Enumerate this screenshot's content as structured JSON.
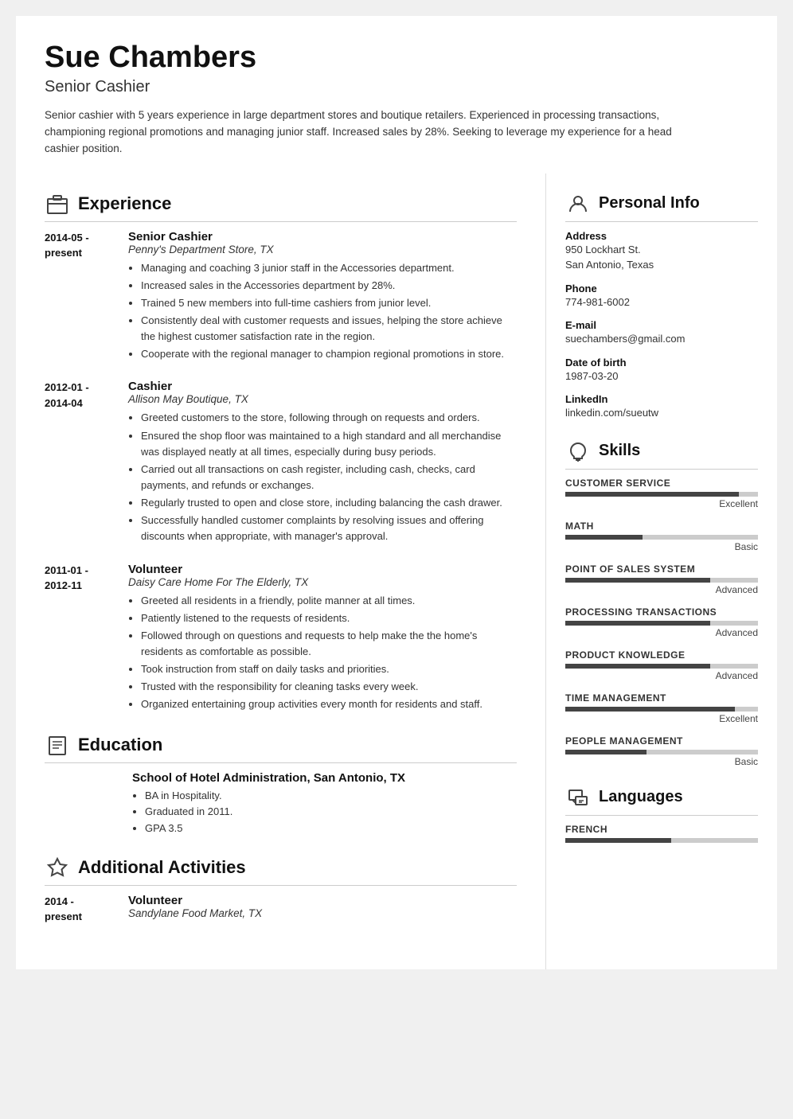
{
  "header": {
    "name": "Sue Chambers",
    "title": "Senior Cashier",
    "summary": "Senior cashier with 5 years experience in large department stores and boutique retailers. Experienced in processing transactions, championing regional promotions and managing junior staff. Increased sales by 28%. Seeking to leverage my experience for a head cashier position."
  },
  "sections": {
    "experience_label": "Experience",
    "education_label": "Education",
    "activities_label": "Additional Activities"
  },
  "experience": [
    {
      "date": "2014-05 -\npresent",
      "title": "Senior Cashier",
      "company": "Penny's Department Store, TX",
      "bullets": [
        "Managing and coaching 3 junior staff in the Accessories department.",
        "Increased sales in the Accessories department by 28%.",
        "Trained 5 new members into full-time cashiers from junior level.",
        "Consistently deal with customer requests and issues, helping the store achieve the highest customer satisfaction rate in the region.",
        "Cooperate with the regional manager to champion regional promotions in store."
      ]
    },
    {
      "date": "2012-01 -\n2014-04",
      "title": "Cashier",
      "company": "Allison May Boutique, TX",
      "bullets": [
        "Greeted customers to the store, following through on requests and orders.",
        "Ensured the shop floor was maintained to a high standard and all merchandise was displayed neatly at all times, especially during busy periods.",
        "Carried out all transactions on cash register, including cash, checks, card payments, and refunds or exchanges.",
        "Regularly trusted to open and close store, including balancing the cash drawer.",
        "Successfully handled customer complaints by resolving issues and offering discounts when appropriate, with manager's approval."
      ]
    },
    {
      "date": "2011-01 -\n2012-11",
      "title": "Volunteer",
      "company": "Daisy Care Home For The Elderly, TX",
      "bullets": [
        "Greeted all residents in a friendly, polite manner at all times.",
        "Patiently listened to the requests of residents.",
        "Followed through on questions and requests to help make the the home's residents as comfortable as possible.",
        "Took instruction from staff on daily tasks and priorities.",
        "Trusted with the responsibility for cleaning tasks every week.",
        "Organized entertaining group activities every month for residents and staff."
      ]
    }
  ],
  "education": [
    {
      "school": "School of Hotel Administration, San Antonio, TX",
      "bullets": [
        "BA in Hospitality.",
        "Graduated in 2011.",
        "GPA 3.5"
      ]
    }
  ],
  "activities": [
    {
      "date": "2014 -\npresent",
      "title": "Volunteer",
      "company": "Sandylane Food Market, TX"
    }
  ],
  "personal_info": {
    "section_label": "Personal Info",
    "address_label": "Address",
    "address_line1": "950 Lockhart St.",
    "address_line2": "San Antonio, Texas",
    "phone_label": "Phone",
    "phone": "774-981-6002",
    "email_label": "E-mail",
    "email": "suechambers@gmail.com",
    "dob_label": "Date of birth",
    "dob": "1987-03-20",
    "linkedin_label": "LinkedIn",
    "linkedin": "linkedin.com/sueutw"
  },
  "skills": {
    "section_label": "Skills",
    "items": [
      {
        "name": "CUSTOMER SERVICE",
        "level": "Excellent",
        "pct": 90
      },
      {
        "name": "MATH",
        "level": "Basic",
        "pct": 40
      },
      {
        "name": "POINT OF SALES SYSTEM",
        "level": "Advanced",
        "pct": 75
      },
      {
        "name": "PROCESSING TRANSACTIONS",
        "level": "Advanced",
        "pct": 75
      },
      {
        "name": "PRODUCT KNOWLEDGE",
        "level": "Advanced",
        "pct": 75
      },
      {
        "name": "TIME MANAGEMENT",
        "level": "Excellent",
        "pct": 88
      },
      {
        "name": "PEOPLE MANAGEMENT",
        "level": "Basic",
        "pct": 42
      }
    ]
  },
  "languages": {
    "section_label": "Languages",
    "items": [
      {
        "name": "FRENCH",
        "pct": 55
      }
    ]
  }
}
